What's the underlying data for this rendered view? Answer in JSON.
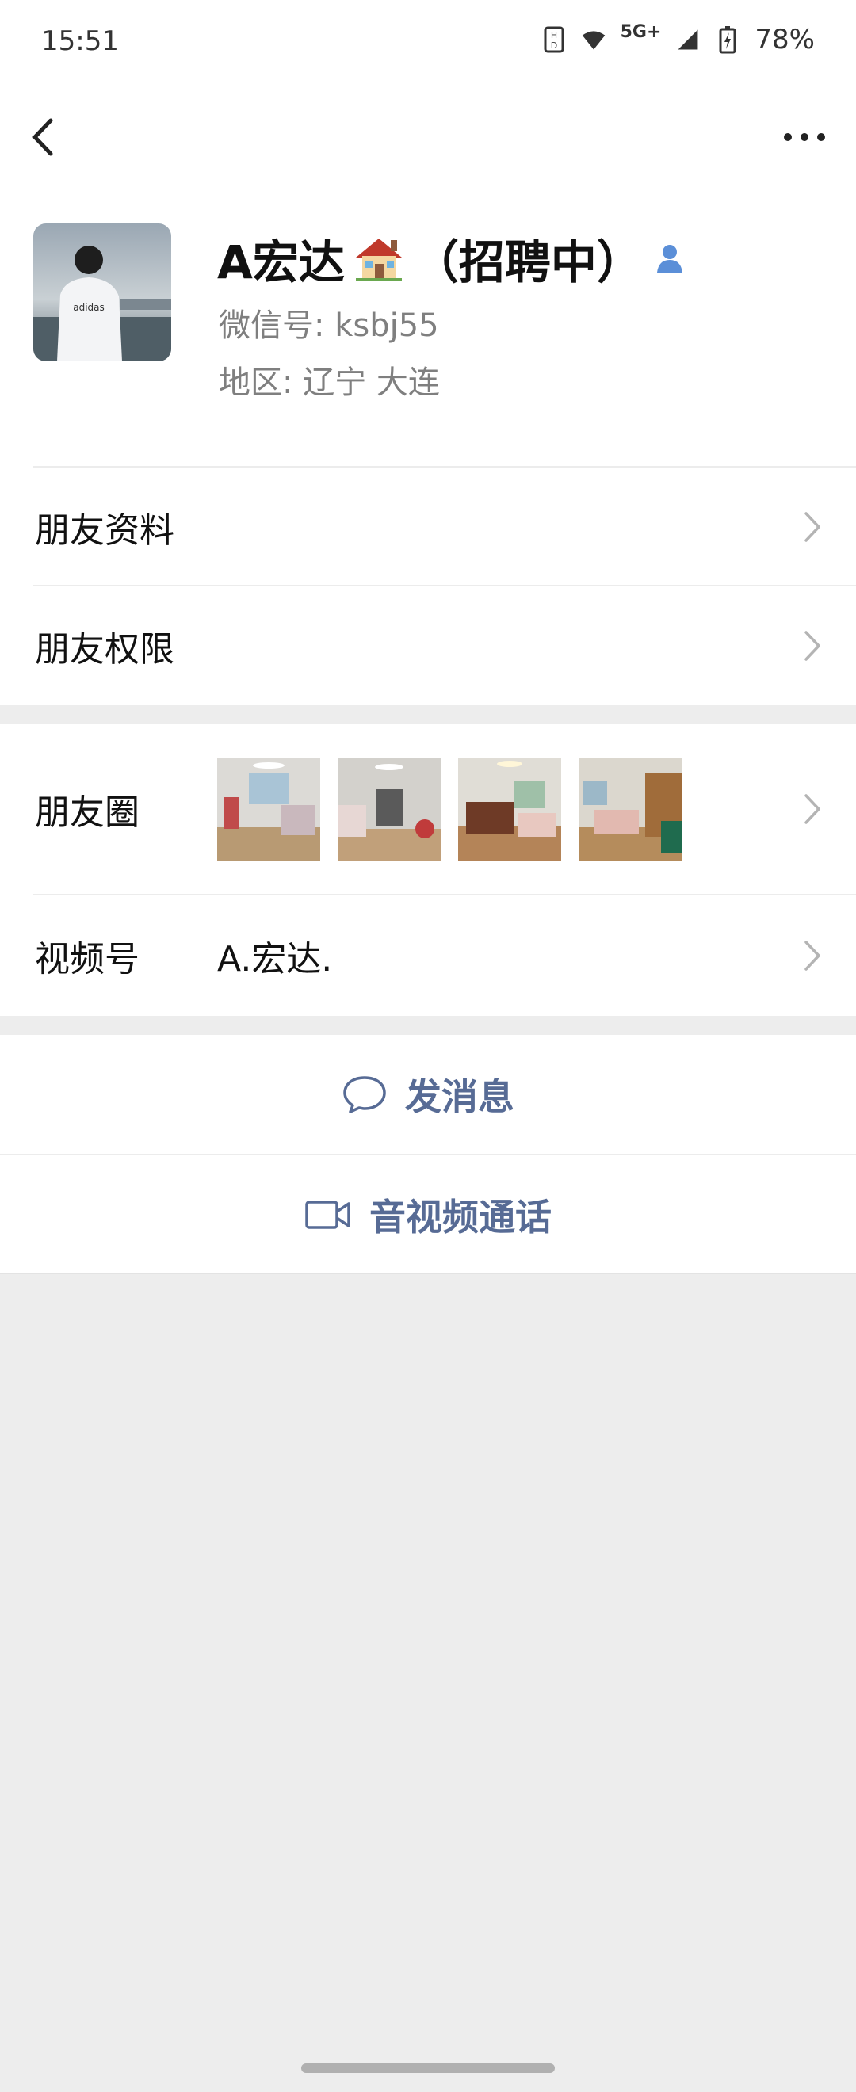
{
  "status_bar": {
    "time": "15:51",
    "network": "5G+",
    "battery": "78%"
  },
  "nav": {
    "back_icon": "chevron-left-icon",
    "more_icon": "more-dots-icon"
  },
  "profile": {
    "name": "A宏达",
    "name_suffix": "（招聘中）",
    "wechat_id": "微信号: ksbj55",
    "region": "地区: 辽宁  大连"
  },
  "menu": {
    "friend_info": "朋友资料",
    "friend_permissions": "朋友权限"
  },
  "moments": {
    "label": "朋友圈",
    "thumbnails": [
      "bedroom-photo-1",
      "bedroom-photo-2",
      "bedroom-photo-3",
      "bedroom-photo-4"
    ]
  },
  "channels": {
    "label": "视频号",
    "value": "A.宏达."
  },
  "actions": {
    "message": "发消息",
    "call": "音视频通话"
  },
  "colors": {
    "link": "#576b95",
    "background": "#ededed",
    "card": "#ffffff"
  }
}
